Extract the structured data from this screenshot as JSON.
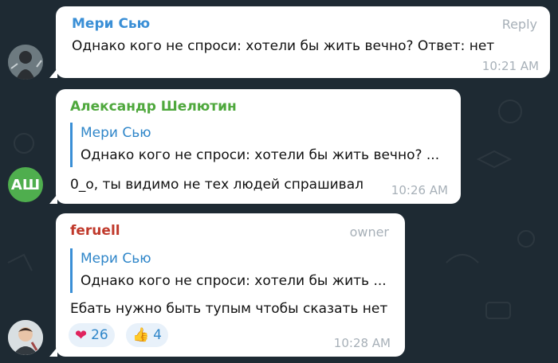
{
  "messages": [
    {
      "sender": "Мери Сью",
      "sender_color": "#3a8fd6",
      "side_label": "Reply",
      "text": "Однако кого не спроси: хотели бы жить вечно? Ответ: нет",
      "time": "10:21 AM"
    },
    {
      "sender": "Александр Шелютин",
      "sender_color": "#4fa83d",
      "avatar_initials": "АШ",
      "avatar_color": "#4fae4e",
      "quote": {
        "name": "Мери Сью",
        "text": "Однако кого не спроси: хотели бы жить вечно? ..."
      },
      "text": "0_o, ты видимо не тех людей спрашивал",
      "time": "10:26 AM"
    },
    {
      "sender": "feruell",
      "sender_color": "#c0392b",
      "side_label": "owner",
      "quote": {
        "name": "Мери Сью",
        "text": "Однако кого не спроси: хотели бы жить ..."
      },
      "text": "Ебать нужно быть тупым чтобы сказать нет",
      "reactions": [
        {
          "icon": "heart-icon",
          "emoji": "❤",
          "count": "26"
        },
        {
          "icon": "thumbs-up-icon",
          "emoji": "👍",
          "count": "4"
        }
      ],
      "time": "10:28 AM"
    }
  ]
}
